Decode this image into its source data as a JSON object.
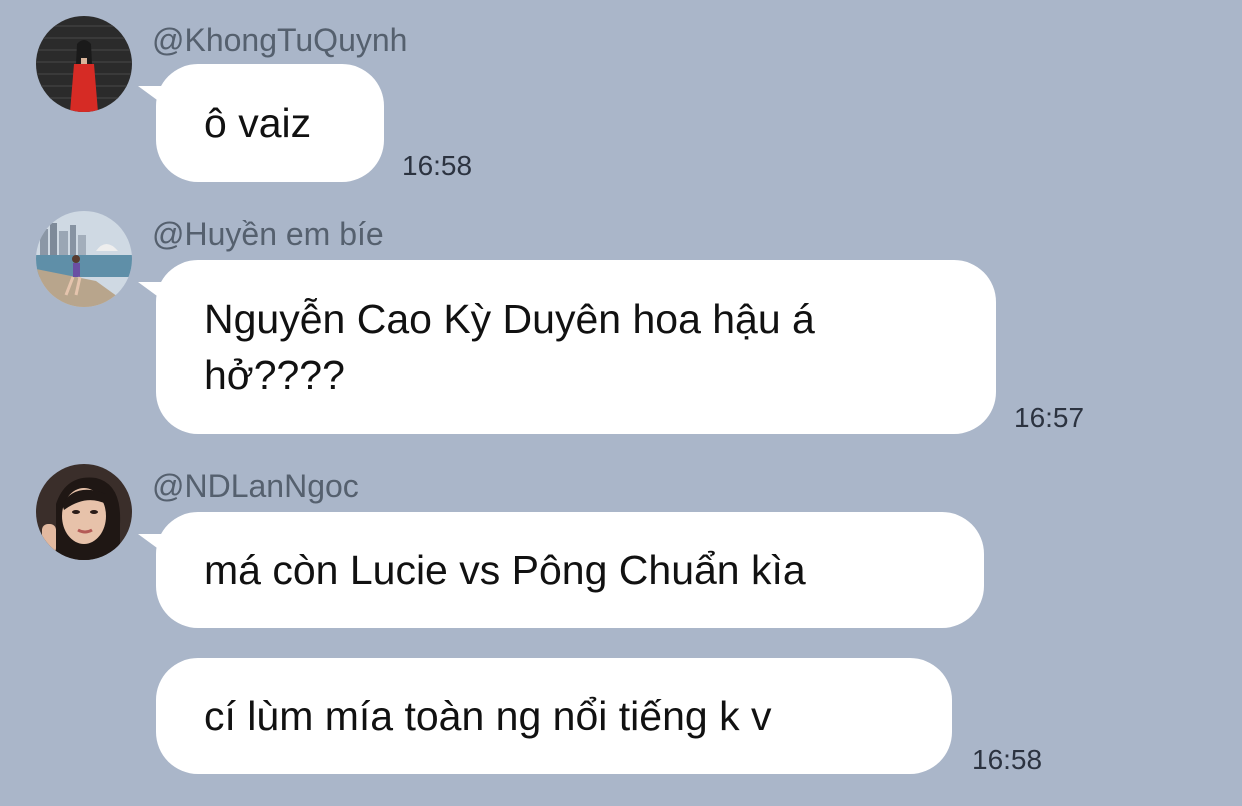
{
  "chat": {
    "messages": [
      {
        "sender": "@KhongTuQuynh",
        "avatar_icon": "avatar-photo-red-dress",
        "texts": [
          "ô vaiz"
        ],
        "time": "16:58"
      },
      {
        "sender": "@Huyền em bíe",
        "avatar_icon": "avatar-photo-seaside-city",
        "texts": [
          "Nguyễn Cao Kỳ Duyên hoa hậu á hở????"
        ],
        "time": "16:57"
      },
      {
        "sender": "@NDLanNgoc",
        "avatar_icon": "avatar-photo-portrait",
        "texts": [
          "má còn Lucie vs Pông Chuẩn kìa",
          "cí lùm mía toàn ng nổi tiếng k v"
        ],
        "time": "16:58"
      }
    ]
  },
  "colors": {
    "background": "#aab6c9",
    "bubble": "#ffffff",
    "sender_text": "#55606e",
    "time_text": "#2c3340"
  }
}
